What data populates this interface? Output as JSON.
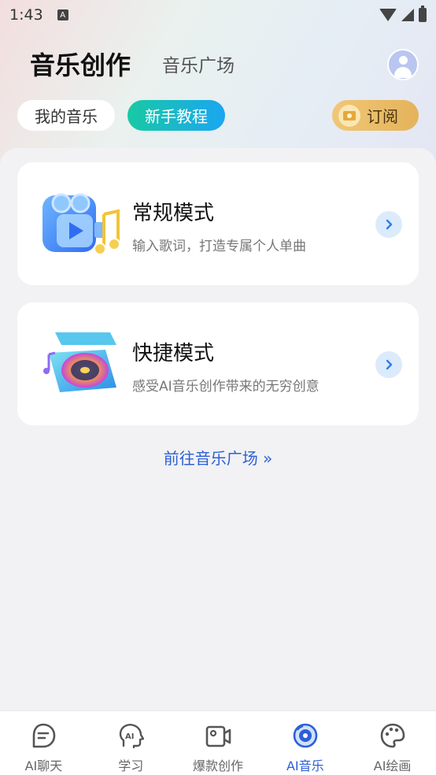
{
  "status_bar": {
    "time": "1:43",
    "notification_icon": "a-icon"
  },
  "header": {
    "title": "音乐创作",
    "tab_plaza": "音乐广场",
    "avatar_icon": "user-avatar-icon"
  },
  "pills": {
    "my_music": "我的音乐",
    "tutorial": "新手教程",
    "subscribe": "订阅"
  },
  "cards": [
    {
      "title": "常规模式",
      "subtitle": "输入歌词，打造专属个人单曲",
      "icon": "video-music-icon"
    },
    {
      "title": "快捷模式",
      "subtitle": "感受AI音乐创作带来的无穷创意",
      "icon": "record-box-icon"
    }
  ],
  "plaza_link": "前往音乐广场 »",
  "bottom_nav": [
    {
      "label": "AI聊天",
      "icon": "chat-icon",
      "active": false
    },
    {
      "label": "学习",
      "icon": "head-ai-icon",
      "active": false
    },
    {
      "label": "爆款创作",
      "icon": "video-create-icon",
      "active": false
    },
    {
      "label": "AI音乐",
      "icon": "vinyl-icon",
      "active": true
    },
    {
      "label": "AI绘画",
      "icon": "palette-icon",
      "active": false
    }
  ],
  "colors": {
    "accent": "#2d5fd6",
    "tutorial_gradient": [
      "#18c9a4",
      "#1ba6f2"
    ],
    "subscribe_gold": "#e4b35a"
  }
}
